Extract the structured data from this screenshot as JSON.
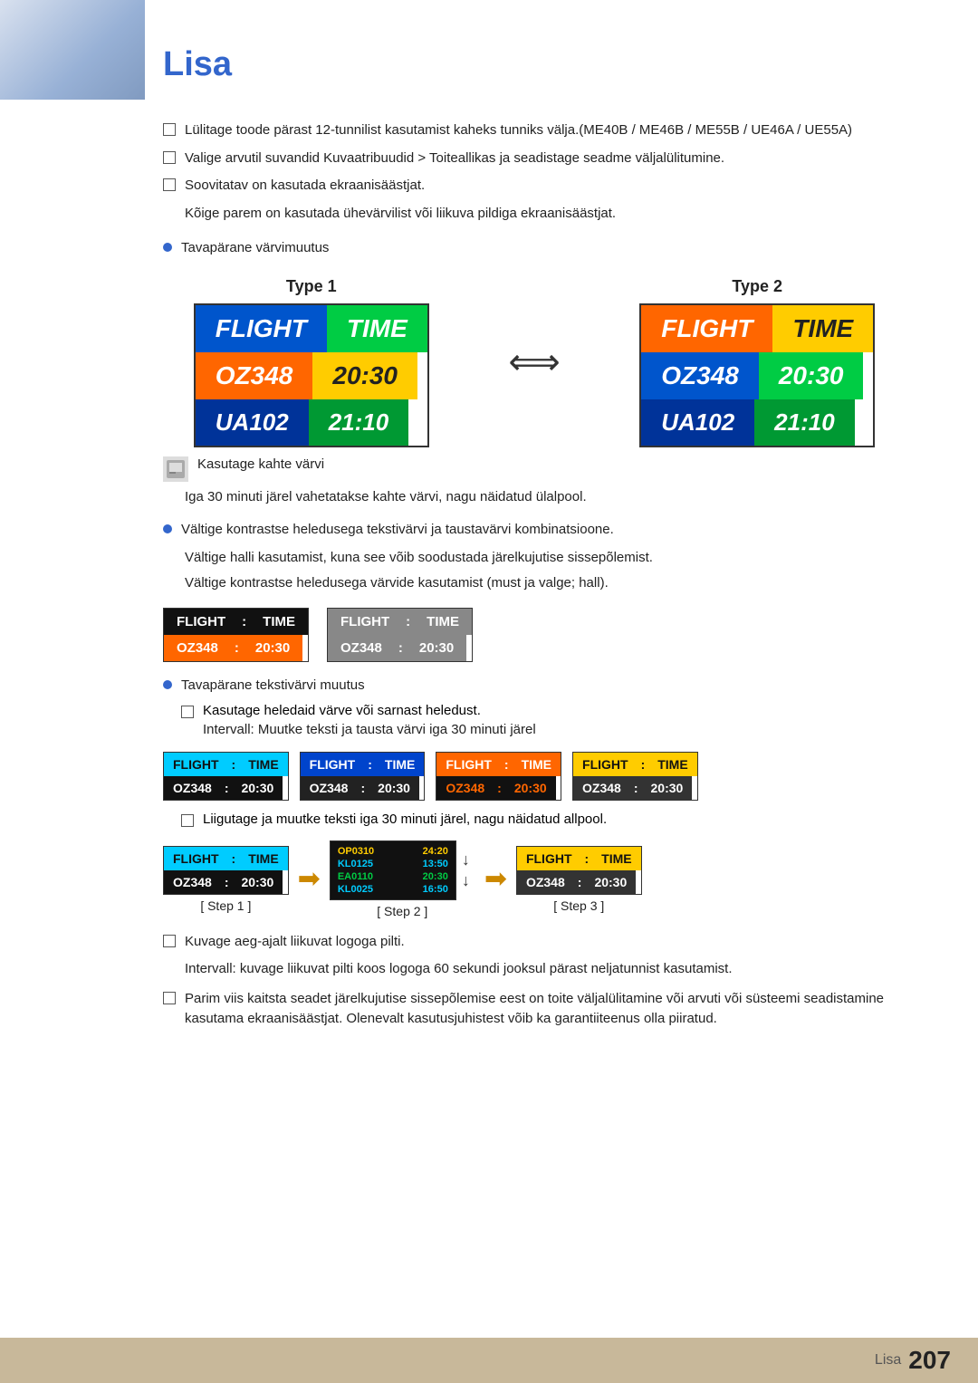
{
  "page": {
    "title": "Lisa",
    "footer_label": "Lisa",
    "footer_page": "207"
  },
  "bullets": {
    "item1": "Lülitage toode pärast 12-tunnilist kasutamist kaheks tunniks välja.(ME40B / ME46B / ME55B / UE46A / UE55A)",
    "item2": "Valige arvutil suvandid Kuvaatribuudid > Toiteallikas ja seadistage seadme väljalülitumine.",
    "item3": "Soovitatav on kasutada ekraanisäästjat.",
    "item3_sub": "Kõige parem on kasutada ühevärvilist või liikuva pildiga ekraanisäästjat.",
    "dot1_label": "Tavapärane värvimuutus",
    "type1_label": "Type 1",
    "type2_label": "Type 2",
    "note_label": "Kasutage kahte värvi",
    "note_sub": "Iga 30 minuti järel vahetatakse kahte värvi, nagu näidatud ülalpool.",
    "dot2_label": "Vältige kontrastse heledusega tekstivärvi ja taustavärvi kombinatsioone.",
    "avoid_sub1": "Vältige halli kasutamist, kuna see võib soodustada järelkujutise sissepõlemist.",
    "avoid_sub2": "Vältige kontrastse heledusega värvide kasutamist (must ja valge; hall).",
    "dot3_label": "Tavapärane tekstivärvi muutus",
    "use_colors": "Kasutage heledaid värve või sarnast heledust.",
    "interval": "Intervall: Muutke teksti ja tausta värvi iga 30 minuti järel",
    "scroll_label": "Liigutage ja muutke teksti iga 30 minuti järel, nagu näidatud allpool.",
    "dot4_label": "Kuvage aeg-ajalt liikuvat logoga pilti.",
    "interval2": "Intervall: kuvage liikuvat pilti koos logoga 60 sekundi jooksul pärast neljatunnist kasutamist.",
    "best_tip": "Parim viis kaitsta seadet järelkujutise sissepõlemise eest on toite väljalülitamine või arvuti või süsteemi seadistamine kasutama ekraanisäästjat. Olenevalt kasutusjuhistest võib ka garantiiteenus olla piiratud."
  },
  "flight_board": {
    "flight_label": "FLIGHT",
    "time_label": "TIME",
    "row1_code": "OZ348",
    "row1_time": "20:30",
    "row2_code": "UA102",
    "row2_time": "21:10"
  },
  "small_board": {
    "flight": "FLIGHT",
    "colon": ":",
    "time": "TIME",
    "code": "OZ348",
    "value": "20:30"
  },
  "color_boards": [
    {
      "header_l": "FLIGHT",
      "header_r": "TIME",
      "data_l": "OZ348",
      "data_r": "20:30",
      "variant": "cv1"
    },
    {
      "header_l": "FLIGHT",
      "header_r": "TIME",
      "data_l": "OZ348",
      "data_r": "20:30",
      "variant": "cv2"
    },
    {
      "header_l": "FLIGHT",
      "header_r": "TIME",
      "data_l": "OZ348",
      "data_r": "20:30",
      "variant": "cv3"
    },
    {
      "header_l": "FLIGHT",
      "header_r": "TIME",
      "data_l": "OZ348",
      "data_r": "20:30",
      "variant": "cv4"
    }
  ],
  "steps": {
    "step1_label": "[ Step 1 ]",
    "step2_label": "[ Step 2 ]",
    "step3_label": "[ Step 3 ]",
    "scroll_rows": [
      {
        "code": "OP0310",
        "time": "24:20",
        "color": "yellow"
      },
      {
        "code": "KL0125",
        "time": "13:50",
        "color": "cyan"
      },
      {
        "code": "EA0110",
        "time": "20:30",
        "color": "green"
      },
      {
        "code": "KL0025",
        "time": "16:50",
        "color": "cyan"
      }
    ]
  }
}
